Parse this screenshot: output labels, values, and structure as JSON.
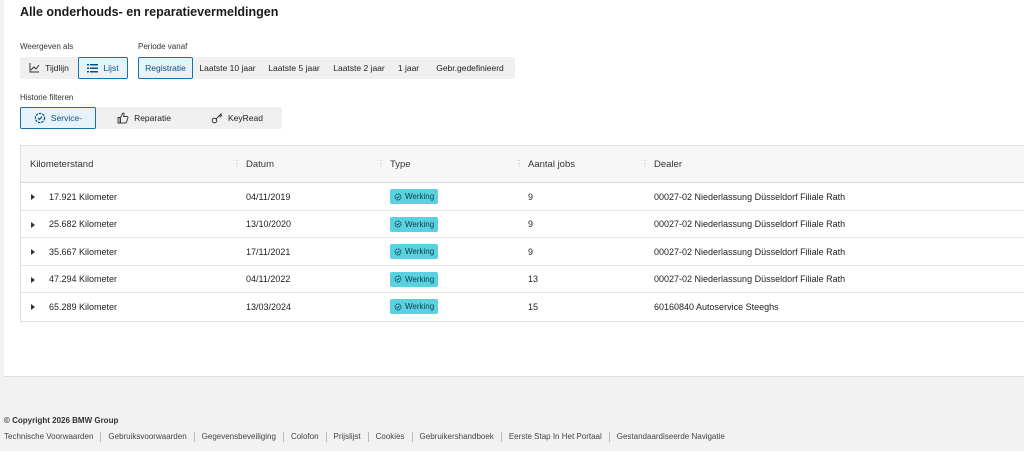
{
  "page": {
    "title": "Alle onderhouds- en reparatievermeldingen"
  },
  "view": {
    "label": "Weergeven als",
    "options": [
      {
        "label": "Tijdlijn",
        "icon": "chart-line-icon",
        "active": false
      },
      {
        "label": "Lijst",
        "icon": "list-icon",
        "active": true
      }
    ]
  },
  "period": {
    "label": "Periode vanaf",
    "options": [
      "Registratie",
      "Laatste 10 jaar",
      "Laatste 5 jaar",
      "Laatste 2 jaar",
      "1 jaar",
      "Gebr.gedefinieerd"
    ],
    "active": "Registratie"
  },
  "filter": {
    "label": "Historie filteren",
    "options": [
      {
        "label": "Service-",
        "icon": "service-gear-icon",
        "active": true
      },
      {
        "label": "Reparatie",
        "icon": "thumbs-up-icon",
        "active": false
      },
      {
        "label": "KeyRead",
        "icon": "key-icon",
        "active": false
      }
    ]
  },
  "table": {
    "headers": [
      "Kilometerstand",
      "Datum",
      "Type",
      "Aantal jobs",
      "Dealer"
    ],
    "rows": [
      {
        "km": "17.921 Kilometer",
        "date": "04/11/2019",
        "type": "Werking",
        "jobs": "9",
        "dealer": "00027-02 Niederlassung Düsseldorf Filiale Rath"
      },
      {
        "km": "25.682 Kilometer",
        "date": "13/10/2020",
        "type": "Werking",
        "jobs": "9",
        "dealer": "00027-02 Niederlassung Düsseldorf Filiale Rath"
      },
      {
        "km": "35.667 Kilometer",
        "date": "17/11/2021",
        "type": "Werking",
        "jobs": "9",
        "dealer": "00027-02 Niederlassung Düsseldorf Filiale Rath"
      },
      {
        "km": "47.294 Kilometer",
        "date": "04/11/2022",
        "type": "Werking",
        "jobs": "13",
        "dealer": "00027-02 Niederlassung Düsseldorf Filiale Rath"
      },
      {
        "km": "65.289 Kilometer",
        "date": "13/03/2024",
        "type": "Werking",
        "jobs": "15",
        "dealer": "60160840 Autoservice Steeghs"
      }
    ]
  },
  "footer": {
    "copyright": "© Copyright 2026 BMW Group",
    "links": [
      "Technische Voorwaarden",
      "Gebruiksvoorwaarden",
      "Gegevensbeveiliging",
      "Colofon",
      "Prijslijst",
      "Cookies",
      "Gebruikershandboek",
      "Eerste Stap In Het Portaal",
      "Gestandaardiseerde Navigatie"
    ]
  },
  "colors": {
    "accent": "#1b6fa8",
    "badge": "#5ad1e0",
    "active_bg": "#e6f3fb"
  }
}
